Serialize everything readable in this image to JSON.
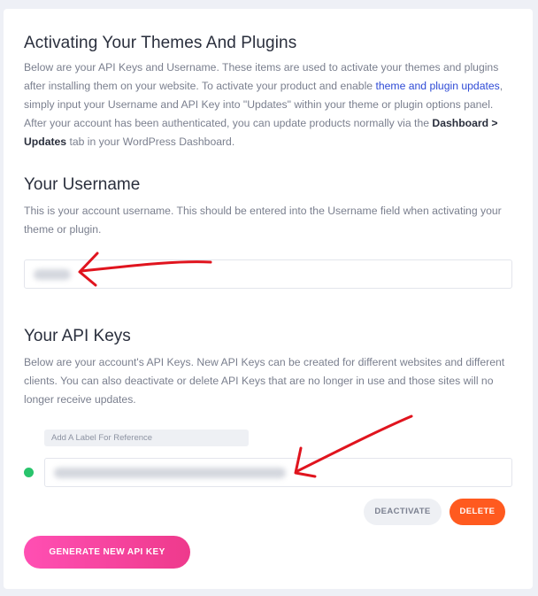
{
  "activation": {
    "title": "Activating Your Themes And Plugins",
    "text_1": "Below are your API Keys and Username. These items are used to activate your themes and plugins after installing them on your website. To activate your product and enable ",
    "link": "theme and plugin updates",
    "text_2": ", simply input your Username and API Key into \"Updates\" within your theme or plugin options panel. After your account has been authenticated, you can update products normally via the ",
    "bold": "Dashboard > Updates",
    "text_3": " tab in your WordPress Dashboard."
  },
  "username": {
    "title": "Your Username",
    "description": "This is your account username. This should be entered into the Username field when activating your theme or plugin."
  },
  "api_keys": {
    "title": "Your API Keys",
    "description": "Below are your account's API Keys. New API Keys can be created for different websites and different clients. You can also deactivate or delete API Keys that are no longer in use and those sites will no longer receive updates.",
    "label_placeholder": "Add A Label For Reference",
    "status_color": "#29c46c",
    "deactivate_label": "DEACTIVATE",
    "delete_label": "DELETE",
    "generate_label": "GENERATE NEW API KEY"
  },
  "colors": {
    "link": "#2f4bd6",
    "annotation_arrow": "#e0141e",
    "delete_button": "#ff5a1f",
    "generate_button": "#ff4fb3"
  }
}
